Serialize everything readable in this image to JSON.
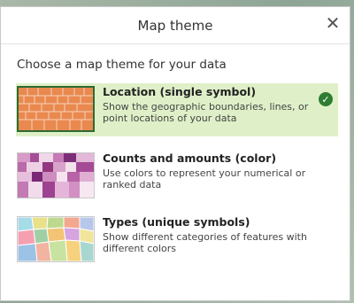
{
  "dialog": {
    "title": "Map theme",
    "prompt": "Choose a map theme for your data"
  },
  "options": [
    {
      "title": "Location (single symbol)",
      "description": "Show the geographic boundaries, lines, or point locations of your data",
      "selected": true,
      "thumbnail": "orange-tiles"
    },
    {
      "title": "Counts and amounts (color)",
      "description": "Use colors to represent your numerical or ranked data",
      "selected": false,
      "thumbnail": "pink-purple-tiles"
    },
    {
      "title": "Types (unique symbols)",
      "description": "Show different categories of features with different colors",
      "selected": false,
      "thumbnail": "multicolor-states"
    }
  ],
  "colors": {
    "selected_bg": "#dff0c8",
    "check_green": "#2f7d32",
    "location_fill": "#e9894f"
  },
  "icons": {
    "close": "close-icon",
    "check": "checkmark-circle-icon"
  }
}
